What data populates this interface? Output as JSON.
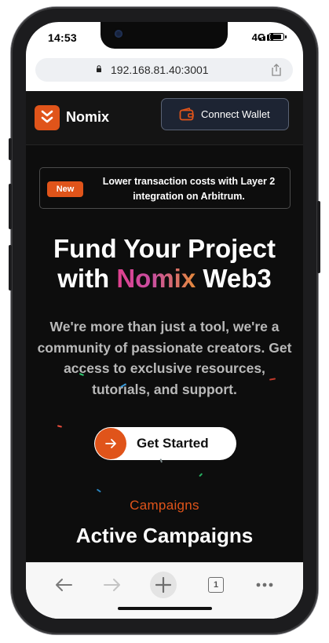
{
  "status_bar": {
    "time": "14:53",
    "network": "4G"
  },
  "browser": {
    "url": "192.168.81.40:3001"
  },
  "site": {
    "brand": "Nomix",
    "connect_label": "Connect Wallet",
    "banner": {
      "badge": "New",
      "text": "Lower transaction costs with Layer 2 integration on Arbitrum."
    },
    "hero": {
      "line1": "Fund Your Project",
      "line2_pre": "with ",
      "line2_highlight": "Nomix",
      "line2_post": " Web3"
    },
    "subtitle": "We're more than just a tool, we're a community of passionate creators. Get access to exclusive resources, tutorials, and support.",
    "cta_label": "Get Started",
    "section_eyebrow": "Campaigns",
    "section_title": "Active Campaigns"
  },
  "toolbar": {
    "tab_count": "1"
  },
  "colors": {
    "accent": "#e0541a",
    "page_bg": "#0d0d0d",
    "nav_bg": "#141414",
    "wallet_btn_bg": "#1d2433"
  }
}
